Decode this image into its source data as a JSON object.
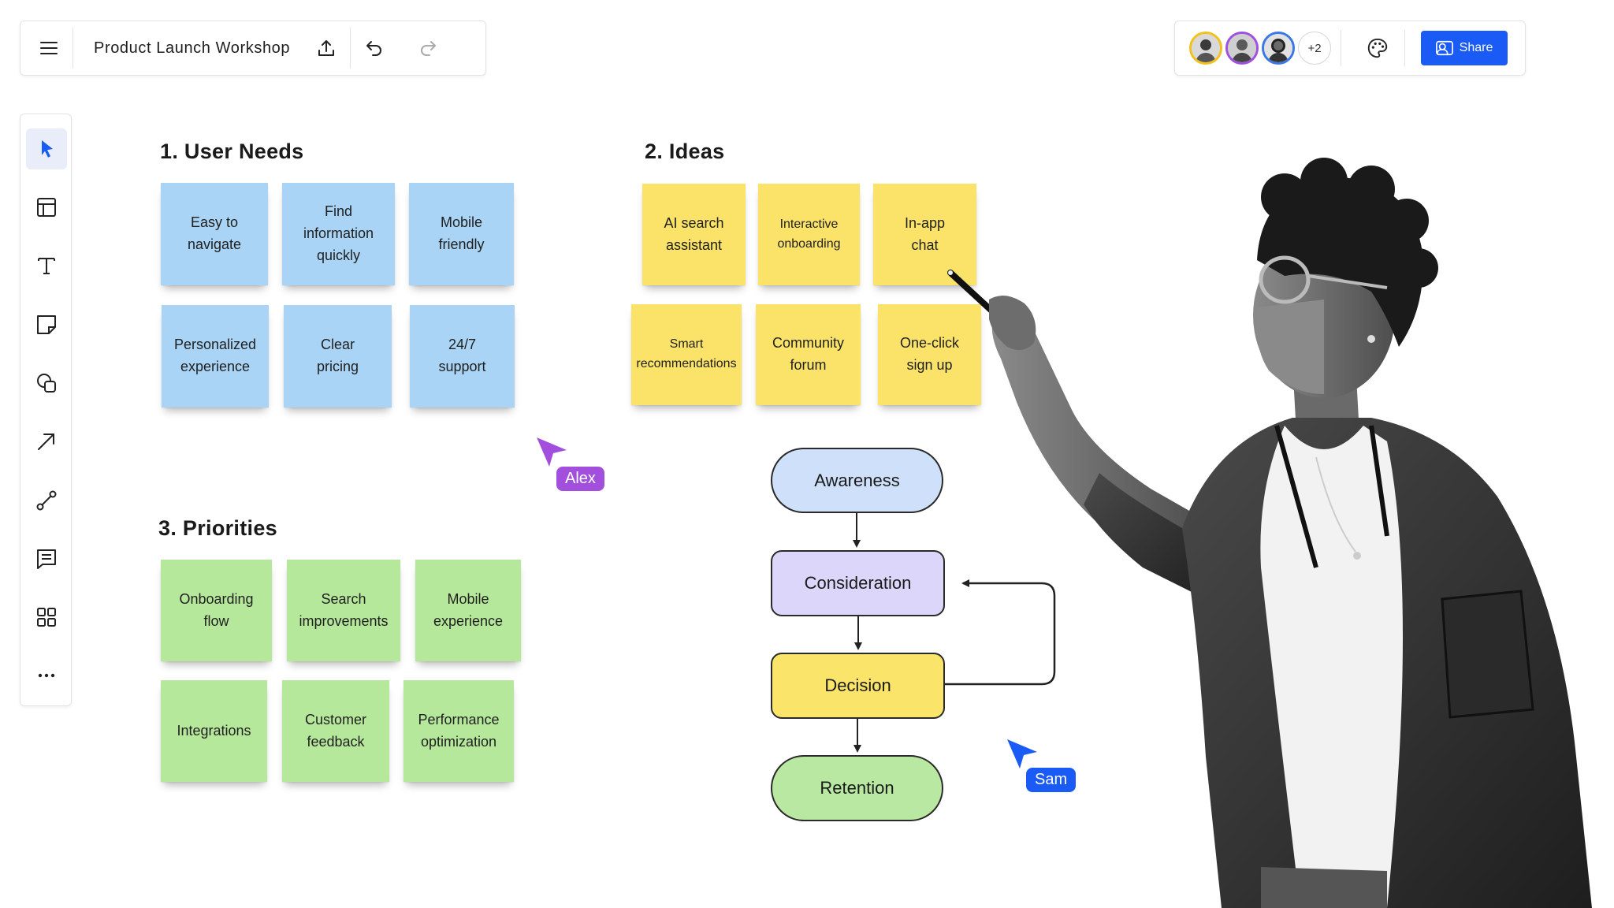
{
  "topbar": {
    "title": "Product Launch Workshop",
    "menu_icon": "menu-icon",
    "export_icon": "upload-icon",
    "undo_icon": "undo-icon",
    "redo_icon": "redo-icon"
  },
  "collaborators": {
    "avatars": [
      {
        "name": "avatar-1",
        "ring": "#f2c21b"
      },
      {
        "name": "avatar-2",
        "ring": "#a14fe0"
      },
      {
        "name": "avatar-3",
        "ring": "#3b78e7"
      }
    ],
    "more_count": "+2",
    "palette_icon": "palette-icon",
    "share_label": "Share",
    "share_color": "#1a5bf5"
  },
  "tools": [
    {
      "name": "select-tool",
      "icon": "cursor-arrow-icon",
      "active": true
    },
    {
      "name": "frame-tool",
      "icon": "layout-icon"
    },
    {
      "name": "text-tool",
      "icon": "text-icon"
    },
    {
      "name": "sticky-tool",
      "icon": "sticky-note-icon"
    },
    {
      "name": "shape-tool",
      "icon": "shapes-icon"
    },
    {
      "name": "arrow-tool",
      "icon": "arrow-icon"
    },
    {
      "name": "connector-tool",
      "icon": "connector-icon"
    },
    {
      "name": "comment-tool",
      "icon": "comment-icon"
    },
    {
      "name": "apps-tool",
      "icon": "grid-icon"
    },
    {
      "name": "more-tool",
      "icon": "more-icon"
    }
  ],
  "sections": {
    "user_needs": {
      "title": "1. User Needs",
      "notes": [
        "Easy to\nnavigate",
        "Find\ninformation\nquickly",
        "Mobile\nfriendly",
        "Personalized\nexperience",
        "Clear\npricing",
        "24/7\nsupport"
      ]
    },
    "ideas": {
      "title": "2. Ideas",
      "notes": [
        "AI search\nassistant",
        "Interactive\nonboarding",
        "In-app\nchat",
        "Smart\nrecommendations",
        "Community\nforum",
        "One-click\nsign up"
      ]
    },
    "priorities": {
      "title": "3. Priorities",
      "notes": [
        "Onboarding\nflow",
        "Search\nimprovements",
        "Mobile\nexperience",
        "Integrations",
        "Customer\nfeedback",
        "Performance\noptimization"
      ]
    }
  },
  "flow": {
    "nodes": [
      {
        "label": "Awareness",
        "color": "#cfe0fb"
      },
      {
        "label": "Consideration",
        "color": "#ddd6fb"
      },
      {
        "label": "Decision",
        "color": "#fbe46a"
      },
      {
        "label": "Retention",
        "color": "#b9e8a2"
      }
    ]
  },
  "cursors": [
    {
      "label": "Alex",
      "color": "#a24fde"
    },
    {
      "label": "Sam",
      "color": "#1a5bf5"
    }
  ],
  "colors": {
    "sticky_blue": "#a9d4f5",
    "sticky_yellow": "#fbe36a",
    "sticky_green": "#b6e89c"
  }
}
